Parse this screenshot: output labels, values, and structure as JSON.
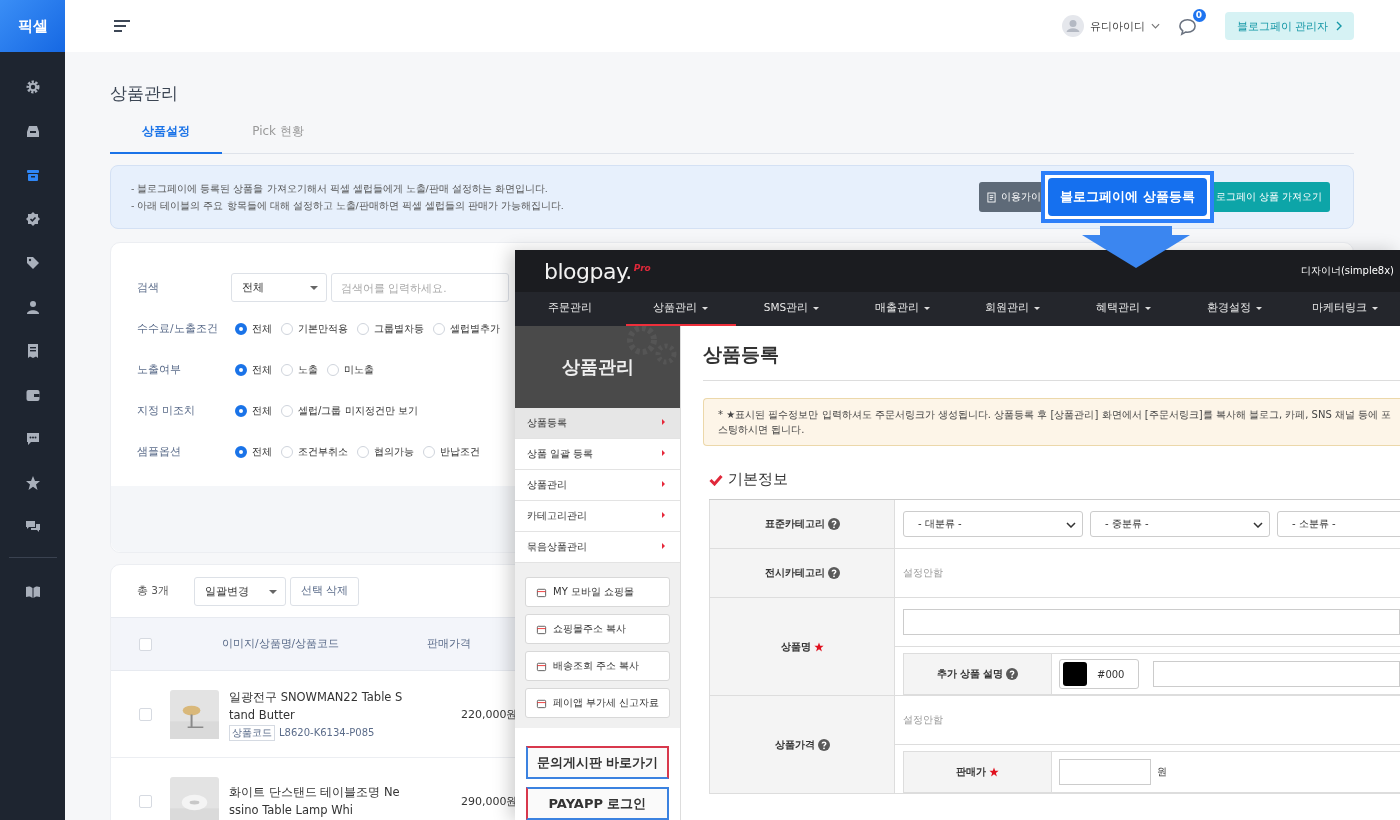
{
  "brand": "픽셀",
  "sidebar": {
    "items": [
      {
        "selected": false
      },
      {
        "selected": false
      },
      {
        "selected": true
      },
      {
        "selected": false
      },
      {
        "selected": false
      },
      {
        "selected": false
      },
      {
        "selected": false
      },
      {
        "selected": false
      },
      {
        "selected": false
      },
      {
        "selected": false
      },
      {
        "selected": false
      },
      {
        "selected": false
      }
    ]
  },
  "topbar": {
    "user": "유디아이디",
    "notifications": "0",
    "admin_button": "블로그페이 관리자"
  },
  "page_title": "상품관리",
  "tabs": [
    {
      "label": "상품설정",
      "selected": true
    },
    {
      "label": "Pick 현황",
      "selected": false
    }
  ],
  "info": {
    "lines": [
      "- 블로그페이에 등록된 상품을 가져오기해서 픽셀 셀럽들에게 노출/판매 설정하는 화면입니다.",
      "- 아래 테이블의 주요 항목들에 대해 설정하고 노출/판매하면 픽셀 셀럽들의 판매가 가능해집니다."
    ],
    "guide_button": "이용가이",
    "register_button": "블로그페이에 상품등록",
    "highlighted": true,
    "import_button": "로그페이 상품 가져오기"
  },
  "filters": {
    "search_label": "검색",
    "search_scope": "전체",
    "search_placeholder": "검색어를 입력하세요.",
    "groups": [
      {
        "label": "수수료/노출조건",
        "options": [
          {
            "label": "전체",
            "selected": true
          },
          {
            "label": "기본만적용",
            "selected": false
          },
          {
            "label": "그룹별차등",
            "selected": false
          },
          {
            "label": "셀럽별추가",
            "selected": false
          }
        ]
      },
      {
        "label": "노출여부",
        "options": [
          {
            "label": "전체",
            "selected": true
          },
          {
            "label": "노출",
            "selected": false
          },
          {
            "label": "미노출",
            "selected": false
          }
        ]
      },
      {
        "label": "지정 미조치",
        "options": [
          {
            "label": "전체",
            "selected": true
          },
          {
            "label": "셀럽/그룹 미지정건만 보기",
            "selected": false
          }
        ]
      },
      {
        "label": "샘플옵션",
        "options": [
          {
            "label": "전체",
            "selected": true
          },
          {
            "label": "조건부취소",
            "selected": false
          },
          {
            "label": "협의가능",
            "selected": false
          },
          {
            "label": "반납조건",
            "selected": false
          }
        ]
      }
    ]
  },
  "list": {
    "all_checked": false,
    "total": "총 3개",
    "bulk_select": "일괄변경",
    "delete_button": "선택 삭제",
    "columns": [
      "이미지/상품명/상품코드",
      "판매가격"
    ],
    "rows": [
      {
        "checked": false,
        "name": "일광전구 SNOWMAN22 Table Stand Butter",
        "code_label": "상품코드",
        "code": "L8620-K6134-P085",
        "price": "220,000원"
      },
      {
        "checked": false,
        "name": "화이트 단스탠드 테이블조명 Nessino Table Lamp Whi",
        "price": "290,000원"
      }
    ]
  },
  "blogpay": {
    "logo": "blogpay.",
    "logo_badge": "Pro",
    "user": "디자이너(simple8x)",
    "nav": [
      {
        "label": "주문관리",
        "selected": false,
        "dropdown": false
      },
      {
        "label": "상품관리",
        "selected": true,
        "dropdown": true
      },
      {
        "label": "SMS관리",
        "selected": false,
        "dropdown": true
      },
      {
        "label": "매출관리",
        "selected": false,
        "dropdown": true
      },
      {
        "label": "회원관리",
        "selected": false,
        "dropdown": true
      },
      {
        "label": "혜택관리",
        "selected": false,
        "dropdown": true
      },
      {
        "label": "환경설정",
        "selected": false,
        "dropdown": true
      },
      {
        "label": "마케터링크",
        "selected": false,
        "dropdown": true
      }
    ],
    "side_title": "상품관리",
    "side_menu": [
      {
        "label": "상품등록",
        "selected": true
      },
      {
        "label": "상품 일괄 등록",
        "selected": false
      },
      {
        "label": "상품관리",
        "selected": false
      },
      {
        "label": "카테고리관리",
        "selected": false
      },
      {
        "label": "묶음상품관리",
        "selected": false
      }
    ],
    "quick_links": [
      "MY 모바일 쇼핑몰",
      "쇼핑몰주소 복사",
      "배송조회 주소 복사",
      "페이앱 부가세 신고자료"
    ],
    "board_button": "문의게시판 바로가기",
    "payapp_button": "PAYAPP 로그인",
    "page_title": "상품등록",
    "notice": "* ★표시된 필수정보만 입력하셔도 주문서링크가 생성됩니다. 상품등록 후 [상품관리] 화면에서 [주문서링크]를 복사해 블로그, 카페, SNS 채널 등에 포스팅하시면 됩니다.",
    "section": "기본정보",
    "rows": [
      {
        "kind": "category",
        "label": "표준카테고리",
        "help": true,
        "required": false,
        "selects": [
          "- 대분류 -",
          "- 중분류 -",
          "- 소분류 -"
        ]
      },
      {
        "kind": "note",
        "label": "전시카테고리",
        "help": true,
        "required": false,
        "note": "설정안함"
      },
      {
        "kind": "name",
        "label": "상품명",
        "help": false,
        "required": true,
        "sub": {
          "label": "추가 상품 설명",
          "help": true,
          "required": false,
          "color": "#000000",
          "color_value": "#000"
        }
      },
      {
        "kind": "price",
        "label": "상품가격",
        "help": true,
        "required": false,
        "note": "설정안함",
        "sub": {
          "label": "판매가",
          "help": false,
          "required": true,
          "unit": "원"
        }
      }
    ]
  }
}
